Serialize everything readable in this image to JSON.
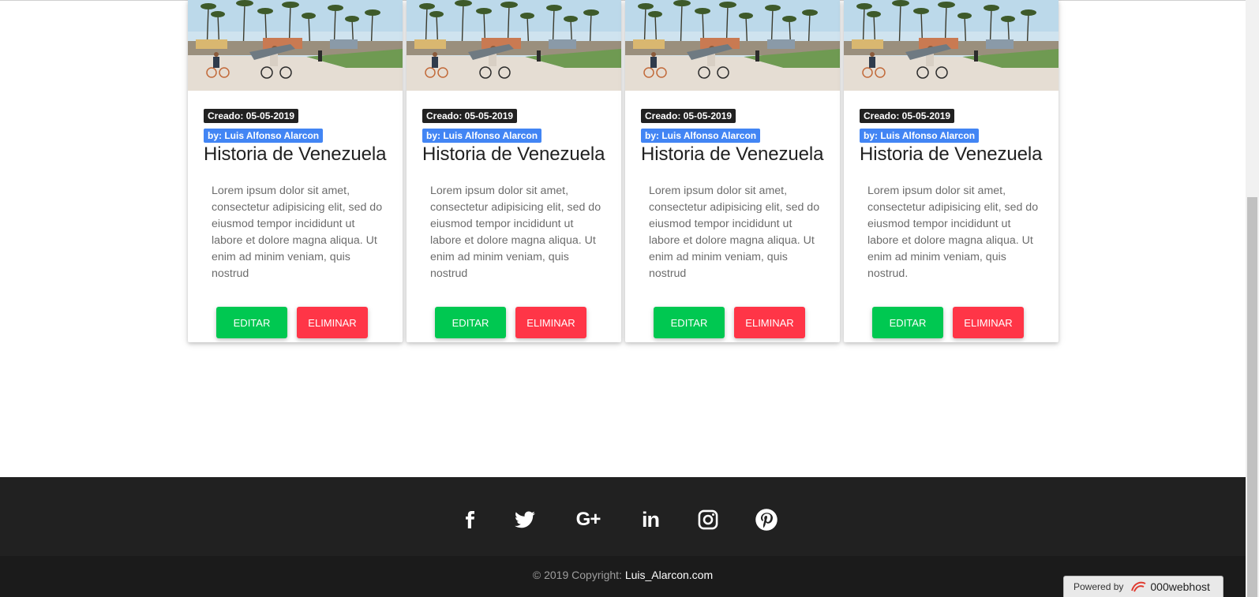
{
  "cards": [
    {
      "image_alt": "beach-cyclists",
      "date_label": "Creado: 05-05-2019",
      "author_label": "by: Luis Alfonso Alarcon",
      "title": "Historia de Venezuela",
      "text": "Lorem ipsum dolor sit amet, consectetur adipisicing elit, sed do eiusmod tempor incididunt ut labore et dolore magna aliqua. Ut enim ad minim veniam, quis nostrud",
      "edit_label": "Editar",
      "delete_label": "Eliminar"
    },
    {
      "image_alt": "beach-cyclists",
      "date_label": "Creado: 05-05-2019",
      "author_label": "by: Luis Alfonso Alarcon",
      "title": "Historia de Venezuela",
      "text": "Lorem ipsum dolor sit amet, consectetur adipisicing elit, sed do eiusmod tempor incididunt ut labore et dolore magna aliqua. Ut enim ad minim veniam, quis nostrud",
      "edit_label": "Editar",
      "delete_label": "Eliminar"
    },
    {
      "image_alt": "beach-cyclists",
      "date_label": "Creado: 05-05-2019",
      "author_label": "by: Luis Alfonso Alarcon",
      "title": "Historia de Venezuela",
      "text": "Lorem ipsum dolor sit amet, consectetur adipisicing elit, sed do eiusmod tempor incididunt ut labore et dolore magna aliqua. Ut enim ad minim veniam, quis nostrud",
      "edit_label": "Editar",
      "delete_label": "Eliminar"
    },
    {
      "image_alt": "beach-cyclists",
      "date_label": "Creado: 05-05-2019",
      "author_label": "by: Luis Alfonso Alarcon",
      "title": "Historia de Venezuela",
      "text": "Lorem ipsum dolor sit amet, consectetur adipisicing elit, sed do eiusmod tempor incididunt ut labore et dolore magna aliqua. Ut enim ad minim veniam, quis nostrud.",
      "edit_label": "Editar",
      "delete_label": "Eliminar"
    }
  ],
  "footer": {
    "social": [
      {
        "name": "facebook-icon"
      },
      {
        "name": "twitter-icon"
      },
      {
        "name": "google-plus-icon"
      },
      {
        "name": "linkedin-icon"
      },
      {
        "name": "instagram-icon"
      },
      {
        "name": "pinterest-icon"
      }
    ],
    "copyright_prefix": "© 2019 Copyright:",
    "copyright_link": "Luis_Alarcon.com"
  },
  "powered": {
    "prefix": "Powered by",
    "brand": "000webhost"
  },
  "colors": {
    "date_badge": "#212121",
    "author_badge": "#4285f4",
    "edit_button": "#00c851",
    "delete_button": "#ff3547",
    "footer_bg": "#212121",
    "copyright_bg": "#1b1b1b"
  }
}
